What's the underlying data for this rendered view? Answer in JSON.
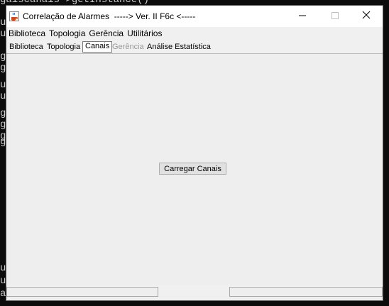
{
  "background_terminal": {
    "lines_top": [
      "gaiscanais->getInstance()",
      "u",
      "u",
      "g",
      "g",
      "u",
      "u",
      "g",
      "g",
      "g",
      "g"
    ],
    "lines_bottom": [
      "u",
      "u",
      "a"
    ]
  },
  "window": {
    "title": "Correlação de Alarmes  -----> Ver. II F6c <-----",
    "icon": "java-cup-icon",
    "controls": {
      "minimize": "minimize-icon",
      "maximize": "maximize-icon",
      "close": "close-icon"
    }
  },
  "menubar": {
    "items": [
      {
        "label": "Biblioteca"
      },
      {
        "label": "Topologia"
      },
      {
        "label": "Gerência"
      },
      {
        "label": "Utilitários"
      }
    ]
  },
  "tabs": [
    {
      "label": "Biblioteca",
      "state": "normal"
    },
    {
      "label": "Topologia",
      "state": "normal"
    },
    {
      "label": "Canais",
      "state": "selected"
    },
    {
      "label": "Gerência",
      "state": "disabled"
    },
    {
      "label": "Análise Estatística",
      "state": "normal"
    }
  ],
  "content": {
    "load_button": "Carregar Canais"
  },
  "colors": {
    "window_bg": "#f0f0f0",
    "terminal_bg": "#0c0c0c",
    "disabled_text": "#9a9a9a"
  }
}
